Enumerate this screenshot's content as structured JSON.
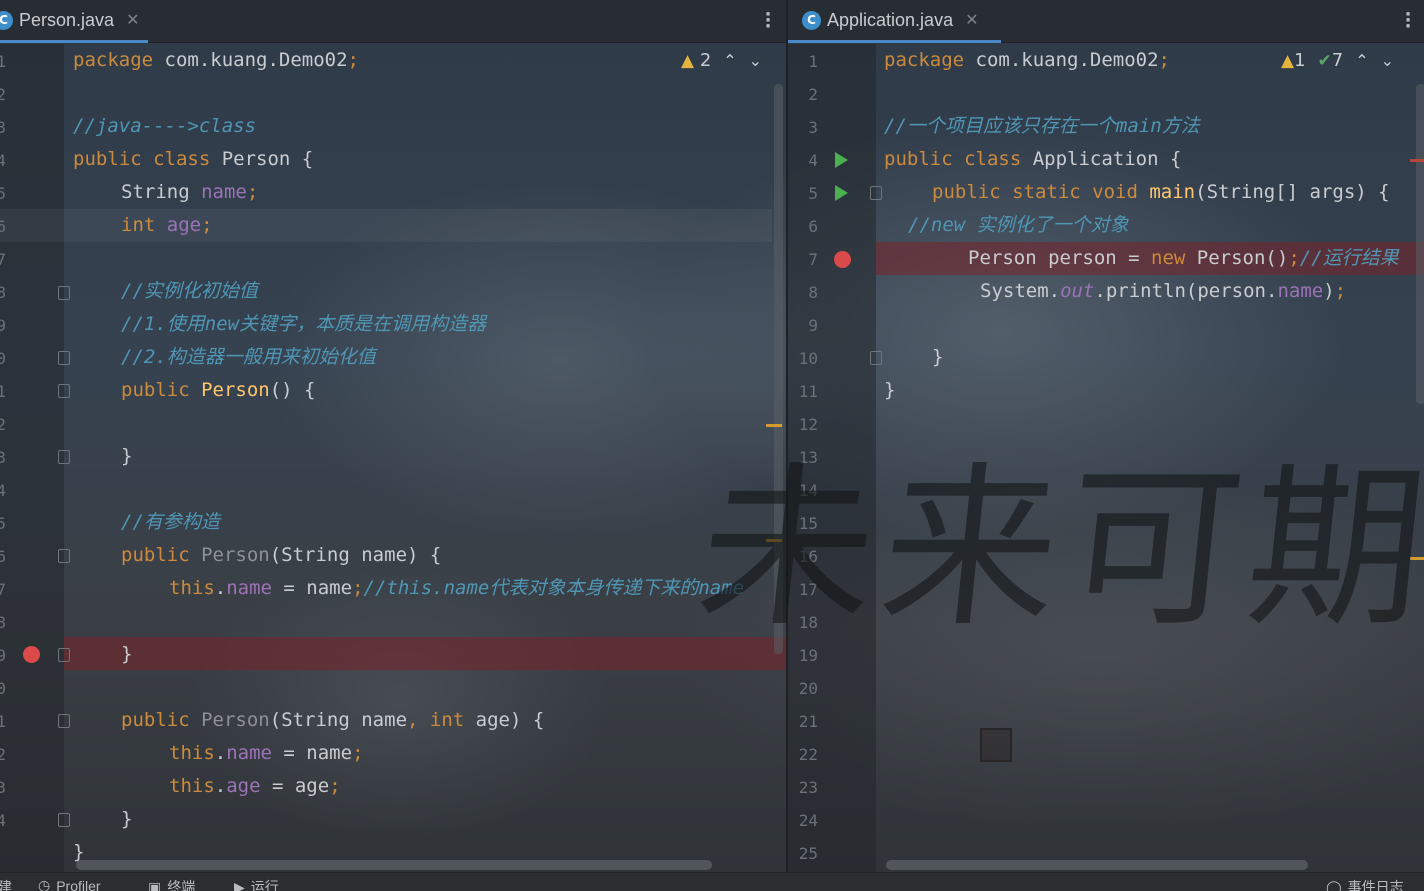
{
  "left_editor": {
    "tab": {
      "icon": "C",
      "label": "Person.java"
    },
    "inspections": {
      "warnings": "2"
    },
    "line_numbers": [
      "1",
      "2",
      "3",
      "4",
      "5",
      "6",
      "7",
      "8",
      "9",
      "0",
      "1",
      "2",
      "3",
      "4",
      "5",
      "6",
      "7",
      "8",
      "9",
      "0",
      "1",
      "2",
      "3",
      "4"
    ],
    "code": {
      "l1_kw": "package",
      "l1_rest": " com.kuang.Demo02",
      "l1_semi": ";",
      "l3": "//java---->class",
      "l4_kw": "public class",
      "l4_rest": " Person {",
      "l5_type": "String",
      "l5_field": "name",
      "l5_semi": ";",
      "l6_kw": "int",
      "l6_field": "age",
      "l6_semi": ";",
      "l8": "//实例化初始值",
      "l9": "//1.使用new关键字，本质是在调用构造器",
      "l10": "//2.构造器一般用来初始化值",
      "l11_kw": "public",
      "l11_fn": "Person",
      "l11_rest": "() {",
      "l13": "}",
      "l15": "//有参构造",
      "l16_kw": "public",
      "l16_name": "Person",
      "l16_rest": "(String name) {",
      "l17_this": "this",
      "l17_dot": ".",
      "l17_field": "name",
      "l17_rest": " = name",
      "l17_semi": ";",
      "l17_cm": "//this.name代表对象本身传递下来的name",
      "l19": "}",
      "l21_kw": "public",
      "l21_name": "Person",
      "l21_a": "(String name",
      "l21_comma": ", ",
      "l21_kw2": "int",
      "l21_b": " age) {",
      "l22_this": "this",
      "l22_field": "name",
      "l22_rest": " = name",
      "l22_semi": ";",
      "l23_this": "this",
      "l23_field": "age",
      "l23_rest": " = age",
      "l23_semi": ";",
      "l24": "}",
      "l25": "}"
    }
  },
  "right_editor": {
    "tab": {
      "icon": "C",
      "label": "Application.java"
    },
    "inspections": {
      "warnings": "1",
      "ok": "7"
    },
    "line_numbers": [
      "1",
      "2",
      "3",
      "4",
      "5",
      "6",
      "7",
      "8",
      "9",
      "10",
      "11",
      "12",
      "13",
      "14",
      "15",
      "16",
      "17",
      "18",
      "19",
      "20",
      "21",
      "22",
      "23",
      "24",
      "25"
    ],
    "code": {
      "l1_kw": "package",
      "l1_rest": " com.kuang.Demo02",
      "l1_semi": ";",
      "l3": "//一个项目应该只存在一个main方法",
      "l4_kw": "public class",
      "l4_rest": " Application {",
      "l5_kw": "public static void",
      "l5_fn": "main",
      "l5_rest": "(String[] args) {",
      "l6": "//new 实例化了一个对象",
      "l7_a": "Person person = ",
      "l7_kw": "new",
      "l7_b": " Person()",
      "l7_semi": ";",
      "l7_cm": "//运行结果",
      "l8_a": "System.",
      "l8_out": "out",
      "l8_b": ".println(person.",
      "l8_field": "name",
      "l8_c": ")",
      "l8_semi": ";",
      "l10": "}",
      "l11": "}"
    }
  },
  "watermark": {
    "text": "未来可期"
  },
  "statusbar": {
    "items": [
      "建",
      "Profiler",
      "终端",
      "运行",
      "事件日志"
    ]
  },
  "colors": {
    "keyword": "#cc8a3d",
    "comment": "#4f96b5",
    "field": "#9b73b6",
    "method": "#ffc66d",
    "breakpoint": "#db4a4a",
    "tab_underline": "#4a88c7"
  }
}
